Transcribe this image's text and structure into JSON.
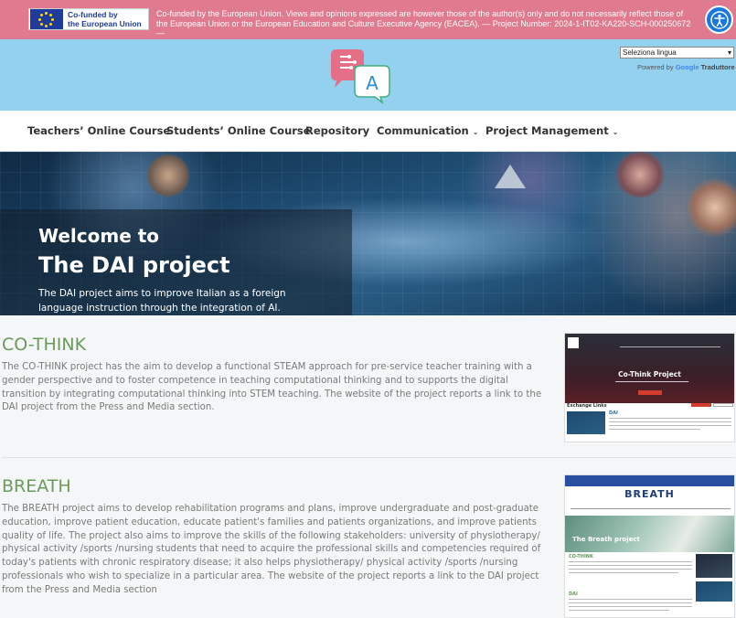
{
  "eu_banner": {
    "logo_line1": "Co-funded by",
    "logo_line2": "the European Union",
    "notice": "Co-funded by the European Union. Views and opinions expressed are however those of the author(s) only and do not necessarily reflect those of the European Union or the European Education and Culture Executive Agency (EACEA). — Project Number: 2024-1-IT02-KA220-SCH-000250672 —"
  },
  "header": {
    "logo_letter": "A",
    "language_select_value": "Seleziona lingua",
    "powered_by_prefix": "Powered by",
    "powered_by_google": "Google",
    "powered_by_suffix": "Traduttore"
  },
  "nav": {
    "items": [
      {
        "label": "Teachers’ Online Course"
      },
      {
        "label": "Students’ Online Course"
      },
      {
        "label": "Repository"
      },
      {
        "label": "Communication"
      },
      {
        "label": "Project Management"
      }
    ]
  },
  "hero": {
    "welcome": "Welcome to",
    "title": "The DAI project",
    "description": "The DAI project aims to improve Italian as a foreign language instruction through the integration of AI."
  },
  "projects": [
    {
      "title": "CO-THINK",
      "text": "The CO-THINK project has the aim to develop a functional STEAM approach for pre-service teacher training with a gender perspective and to foster competence in teaching computational thinking and to supports the digital transition by integrating computational thinking into STEM teaching. The website of the project reports a link to the DAI project from the Press and Media section.",
      "thumb_title": "Co-Think Project",
      "thumb_section": "Exchange Links",
      "thumb_item": "DAI"
    },
    {
      "title": "BREATH",
      "text": "The BREATH project aims to develop rehabilitation programs and plans, improve undergraduate and post-graduate education, improve patient education, educate patient's families and patients organizations, and improve patients quality of life. The project also aims to improve the skills of the following stakeholders: university of physiotherapy/ physical activity /sports /nursing students that need to acquire the professional skills and competencies required of today's patients with chronic respiratory disease; it also helps physiotherapy/ physical activity /sports /nursing professionals who wish to specialize in a particular area. The website of the project reports a link to the DAI project from the Press and Media section",
      "thumb_title": "BREATH",
      "thumb_hero": "The Breath project",
      "thumb_section": "CO-THINK",
      "thumb_item": "DAI"
    }
  ],
  "colors": {
    "eu_bar": "#e07a8f",
    "header_bg": "#93d1ef",
    "project_title": "#6b9b5b",
    "accessibility": "#1877e0"
  }
}
